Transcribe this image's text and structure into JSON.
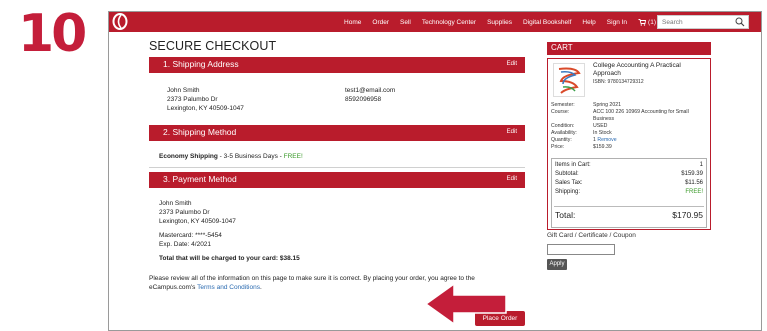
{
  "step_number": "10",
  "colors": {
    "brand": "#b91c2c",
    "step_number": "#c41e3a",
    "free": "#3a9a2a",
    "link": "#2a6ab0"
  },
  "nav": {
    "links": [
      "Home",
      "Order",
      "Sell",
      "Technology Center",
      "Supplies",
      "Digital Bookshelf",
      "Help",
      "Sign In"
    ],
    "cart_label": "(1)",
    "search_placeholder": "Search"
  },
  "page_title": "SECURE CHECKOUT",
  "shipping_address": {
    "heading": "1. Shipping Address",
    "edit": "Edit",
    "name": "John Smith",
    "street": "2373 Palumbo Dr",
    "city": "Lexington, KY 40509-1047",
    "email": "test1@email.com",
    "phone": "8592096958"
  },
  "shipping_method": {
    "heading": "2. Shipping Method",
    "edit": "Edit",
    "method": "Economy Shipping",
    "detail": " - 3-5 Business Days - ",
    "free": "FREE!"
  },
  "payment_method": {
    "heading": "3. Payment Method",
    "edit": "Edit",
    "name": "John Smith",
    "street": "2373 Palumbo Dr",
    "city": "Lexington, KY 40509-1047",
    "card": "Mastercard: ****-5454",
    "exp": "Exp. Date: 4/2021",
    "total_charge": "Total that will be charged to your card: $38.15"
  },
  "review": {
    "line1": "Please review all of the information on this page to make sure it is correct. By placing your order, you agree to the",
    "line2_prefix": "eCampus.com's ",
    "terms_link": "Terms and Conditions",
    "line2_suffix": "."
  },
  "place_order": "Place Order",
  "cart": {
    "heading": "CART",
    "book_title": "College Accounting A Practical Approach",
    "isbn": "ISBN: 9780134729312",
    "fields": [
      {
        "label": "Semester:",
        "value": "Spring 2021"
      },
      {
        "label": "Course:",
        "value": "ACC 100 226 10969 Accounting for Small"
      },
      {
        "label": "",
        "value": "Business"
      },
      {
        "label": "Condition:",
        "value": "USED"
      },
      {
        "label": "Availability:",
        "value": "In Stock"
      },
      {
        "label": "Quantity:",
        "value": "1",
        "link": "Remove"
      },
      {
        "label": "Price:",
        "value": "$159.39"
      }
    ],
    "summary": {
      "items_label": "Items in Cart:",
      "items_value": "1",
      "subtotal_label": "Subtotal:",
      "subtotal_value": "$159.39",
      "tax_label": "Sales Tax:",
      "tax_value": "$11.56",
      "shipping_label": "Shipping:",
      "shipping_value": "FREE!",
      "total_label": "Total:",
      "total_value": "$170.95"
    },
    "gift_label": "Gift Card / Certificate / Coupon",
    "apply": "Apply"
  }
}
